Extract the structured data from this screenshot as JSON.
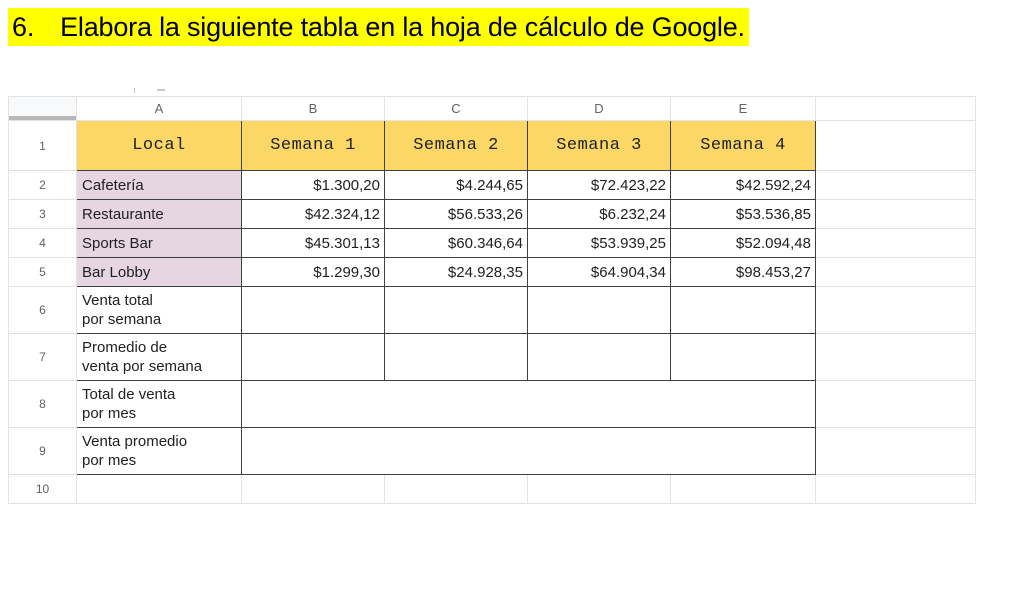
{
  "instruction": {
    "number": "6.",
    "text": "Elabora la siguiente tabla en la hoja de cálculo de Google.",
    "highlight_color": "#ffff00",
    "text_color": "#000000"
  },
  "spreadsheet": {
    "app": "Google Sheets",
    "column_headers": [
      "A",
      "B",
      "C",
      "D",
      "E",
      ""
    ],
    "row_headers": [
      "1",
      "2",
      "3",
      "4",
      "5",
      "6",
      "7",
      "8",
      "9",
      "10"
    ],
    "colors": {
      "header_fill": "#fbd765",
      "name_fill": "#e6d5e3",
      "grid_line": "#e3e3e3",
      "user_border": "#3c4043",
      "row_header_text": "#5f6368",
      "cell_text": "#202124"
    },
    "table": {
      "headers": [
        "Local",
        "Semana 1",
        "Semana 2",
        "Semana 3",
        "Semana 4"
      ],
      "rows": [
        {
          "label": "Cafetería",
          "label_style": "name",
          "values": [
            "$1.300,20",
            "$4.244,65",
            "$72.423,22",
            "$42.592,24"
          ]
        },
        {
          "label": "Restaurante",
          "label_style": "name",
          "values": [
            "$42.324,12",
            "$56.533,26",
            "$6.232,24",
            "$53.536,85"
          ]
        },
        {
          "label": "Sports Bar",
          "label_style": "name",
          "values": [
            "$45.301,13",
            "$60.346,64",
            "$53.939,25",
            "$52.094,48"
          ]
        },
        {
          "label": "Bar Lobby",
          "label_style": "name",
          "values": [
            "$1.299,30",
            "$24.928,35",
            "$64.904,34",
            "$98.453,27"
          ]
        },
        {
          "label_line1": "Venta total",
          "label_line2": "por semana",
          "label_style": "plain",
          "values": [
            "",
            "",
            "",
            ""
          ]
        },
        {
          "label_line1": "Promedio de",
          "label_line2": "venta por semana",
          "label_style": "plain",
          "values": [
            "",
            "",
            "",
            ""
          ]
        },
        {
          "label_line1": "Total de venta",
          "label_line2": "por mes",
          "label_style": "plain",
          "merged": true,
          "merged_value": ""
        },
        {
          "label_line1": "Venta promedio",
          "label_line2": "por mes",
          "label_style": "plain",
          "merged": true,
          "merged_value": ""
        }
      ]
    }
  }
}
